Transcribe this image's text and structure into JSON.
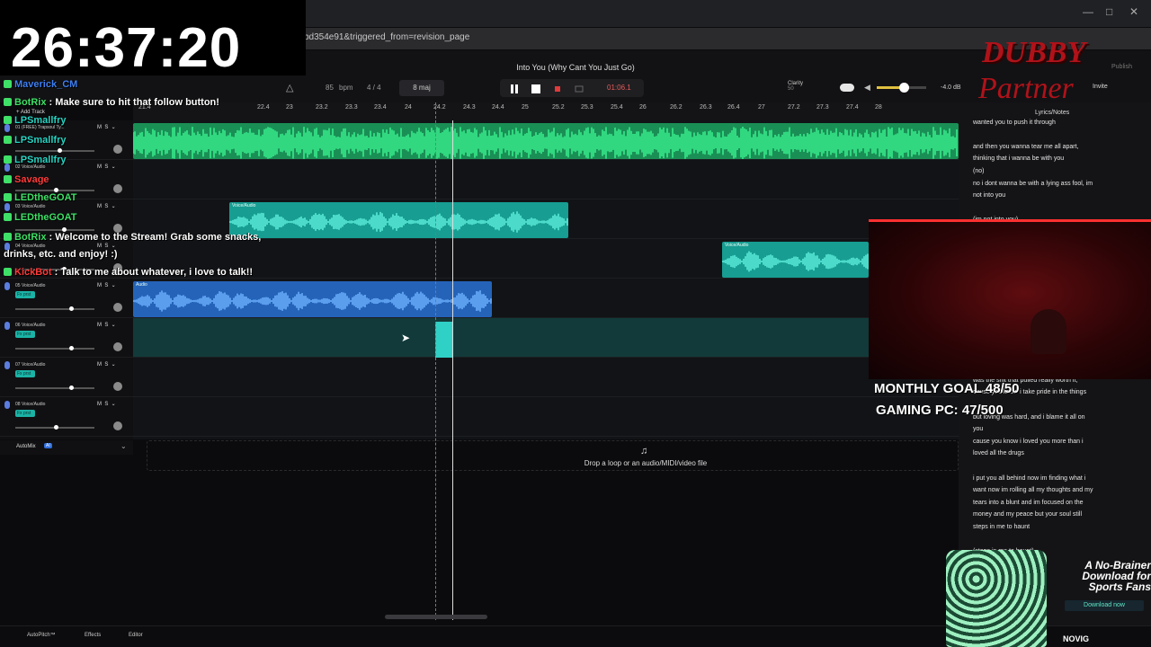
{
  "browser": {
    "url_fragment": "bd354e91&triggered_from=revision_page"
  },
  "clock": "26:37:20",
  "project": {
    "title": "Into You (Why Cant You Just Go)",
    "bpm_value": "85",
    "bpm_unit": "bpm",
    "time_signature": "4 / 4",
    "bars": "8 maj",
    "time_readout": "01:06.1",
    "clarity_label": "Clarity",
    "clarity_value": "50",
    "volume_db": "-4.0 dB",
    "volume_level": 0.55,
    "invite_label": "Invite",
    "publish_label": "Publish",
    "lyrics_label": "Lyrics/Notes",
    "drop_hint": "Drop a loop or an audio/MIDI/video file",
    "add_track_label": "+ Add Track",
    "automix_label": "AutoMix",
    "automix_badge": "AI"
  },
  "ruler": [
    "21.4",
    "22.4",
    "23",
    "23.2",
    "23.3",
    "23.4",
    "24",
    "24.2",
    "24.3",
    "24.4",
    "25",
    "25.2",
    "25.3",
    "25.4",
    "26",
    "26.2",
    "26.3",
    "26.4",
    "27",
    "27.2",
    "27.3",
    "27.4",
    "28"
  ],
  "tracks": [
    {
      "num": "01",
      "name": "(FREE) Trapsoul Ty...",
      "fx": "",
      "fader": 0.55
    },
    {
      "num": "02",
      "name": "Voice/Audio",
      "fx": "",
      "fader": 0.5
    },
    {
      "num": "03",
      "name": "Voice/Audio",
      "fx": "",
      "fader": 0.6
    },
    {
      "num": "04",
      "name": "Voice/Audio",
      "fx": "",
      "fader": 0.6
    },
    {
      "num": "05",
      "name": "Voice/Audio",
      "fx": "Fx prst",
      "fader": 0.7
    },
    {
      "num": "06",
      "name": "Voice/Audio",
      "fx": "Fx prst",
      "fader": 0.7
    },
    {
      "num": "07",
      "name": "Voice/Audio",
      "fx": "Fx prst",
      "fader": 0.7
    },
    {
      "num": "08",
      "name": "Voice/Audio",
      "fx": "Fx prst",
      "fader": 0.5
    }
  ],
  "clips": [
    {
      "label": "Voice/Audio"
    },
    {
      "label": "Voice/Audio"
    },
    {
      "label": "Audio"
    }
  ],
  "bottom": {
    "autopitch": "AutoPitch™",
    "effects": "Effects",
    "editor": "Editor"
  },
  "chat": [
    {
      "user": "Maverick_CM",
      "text": ""
    },
    {
      "user": "BotRix",
      "text": "Make sure to hit that follow button!"
    },
    {
      "user": "LPSmallfry",
      "text": ""
    },
    {
      "user": "LPSmallfry",
      "text": ""
    },
    {
      "user": "LPSmallfry",
      "text": ""
    },
    {
      "user": "Savage",
      "text": ""
    },
    {
      "user": "LEDtheGOAT",
      "text": ""
    },
    {
      "user": "LEDtheGOAT",
      "text": ""
    },
    {
      "user": "BotRix",
      "text": "Welcome to the Stream! Grab some snacks,"
    },
    {
      "user": "",
      "text": "drinks, etc. and enjoy! :)"
    },
    {
      "user": "KickBot",
      "text": "Talk to me about whatever, i love to talk!!"
    }
  ],
  "goals": {
    "monthly": "MONTHLY GOAL 48/50",
    "gaming": "GAMING PC: 47/500"
  },
  "lyrics": [
    "wanted you to push it through",
    "and then you wanna tear me all apart,",
    "thinking that i wanna be with you",
    "(no)",
    "no i dont wanna be with a lying ass fool, im",
    "not into you",
    "(im not into you)",
    "was the shit that pulled really worth it,",
    "cause you know i take pride in the things",
    "but loving was hard, and i blame it all on",
    "you",
    "cause you know i loved you more than i",
    "loved all the drugs",
    "i put you all behind now im finding what i",
    "want now im rolling all my thoughts and my",
    "tears into a blunt and im focused on the",
    "money and my peace but your soul still",
    "steps in me to haunt",
    "(steps in me to haunt)"
  ],
  "logo": {
    "line1": "DUBBY",
    "line2": "Partner"
  },
  "ad": {
    "headline": "A No-Brainer Download for Sports Fans",
    "cta": "Download now",
    "brand": "NOVIG"
  },
  "colors": {
    "track1": "#25d07a",
    "vocal_teal": "#1cc6b6",
    "vocal_blue": "#3f8ee8",
    "chat_green": "#3fe067",
    "chat_red": "#ff3b3b"
  }
}
